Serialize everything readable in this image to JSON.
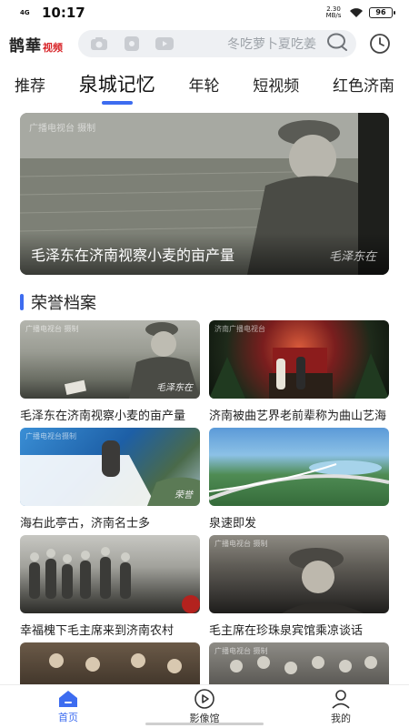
{
  "status_bar": {
    "network": "4G",
    "time": "10:17",
    "speed_value": "2.30",
    "speed_unit": "MB/s",
    "battery": "96"
  },
  "header": {
    "logo_main": "鹊華",
    "logo_sub": "视频",
    "search_placeholder": "冬吃萝卜夏吃姜"
  },
  "tabs": [
    {
      "label": "推荐",
      "active": false
    },
    {
      "label": "泉城记忆",
      "active": true
    },
    {
      "label": "年轮",
      "active": false
    },
    {
      "label": "短视频",
      "active": false
    },
    {
      "label": "红色济南",
      "active": false
    }
  ],
  "hero": {
    "watermark": "广播电视台   摄制",
    "title": "毛泽东在济南视察小麦的亩产量",
    "signature": "毛泽东在"
  },
  "section": {
    "title": "荣誉档案"
  },
  "cards": [
    {
      "title": "毛泽东在济南视察小麦的亩产量",
      "watermark": "广播电视台   摄制",
      "signature": "毛泽东在"
    },
    {
      "title": "济南被曲艺界老前辈称为曲山艺海",
      "watermark": "济南广播电视台",
      "signature": ""
    },
    {
      "title": "海右此亭古，济南名士多",
      "watermark": "广播电视台摄制",
      "signature": "荣誉"
    },
    {
      "title": "泉速即发",
      "watermark": "",
      "signature": ""
    },
    {
      "title": "幸福槐下毛主席来到济南农村",
      "watermark": "",
      "signature": ""
    },
    {
      "title": "毛主席在珍珠泉宾馆乘凉谈话",
      "watermark": "广播电视台   摄制",
      "signature": ""
    },
    {
      "title": "",
      "watermark": "",
      "signature": ""
    },
    {
      "title": "",
      "watermark": "广播电视台   摄制",
      "signature": ""
    }
  ],
  "bottom_nav": [
    {
      "label": "首页",
      "icon": "home-icon",
      "active": true
    },
    {
      "label": "影像馆",
      "icon": "play-circle-icon",
      "active": false
    },
    {
      "label": "我的",
      "icon": "user-icon",
      "active": false
    }
  ],
  "colors": {
    "accent": "#3d6cf0",
    "logo_red": "#d8262a",
    "search_bg": "#eef0f3"
  }
}
